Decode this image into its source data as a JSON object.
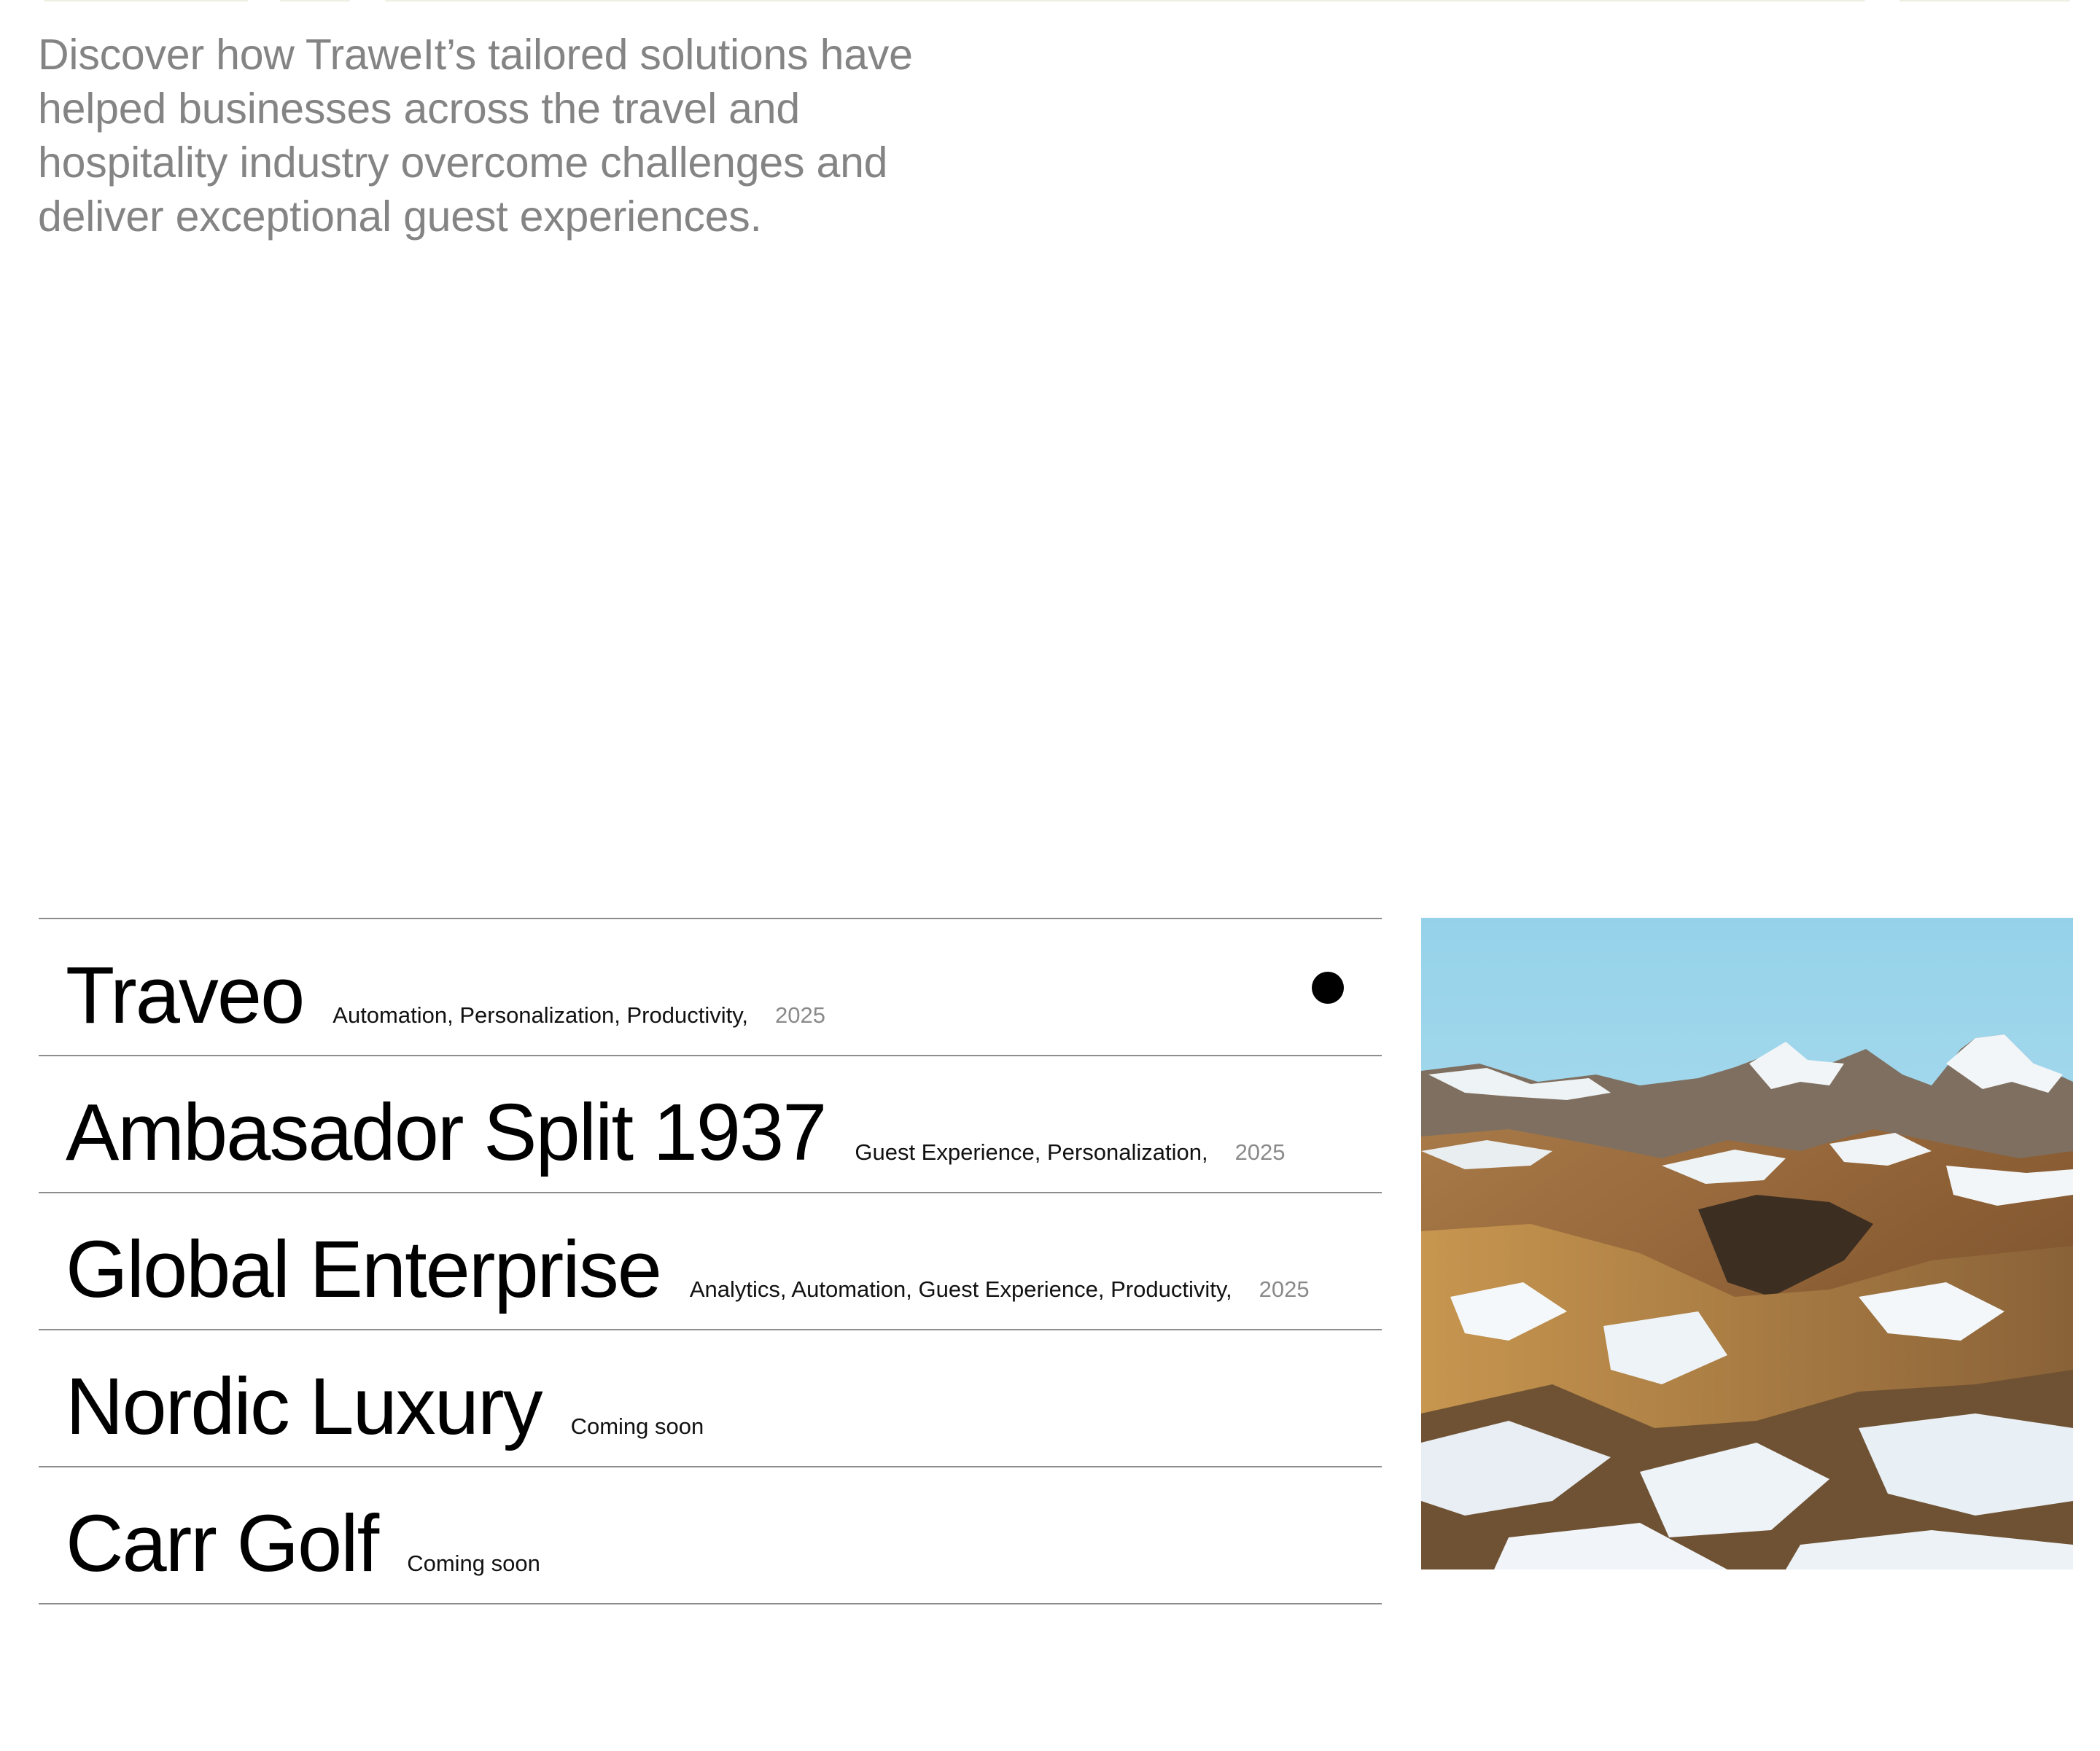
{
  "intro": {
    "text": "Discover how TraweIt’s tailored solutions have helped businesses across the travel and hospitality industry overcome challenges and deliver exceptional guest experiences."
  },
  "cases": [
    {
      "title": "Traveo",
      "tags": "Automation, Personalization, Productivity,",
      "year": "2025",
      "active": true
    },
    {
      "title": "Ambasador Split 1937",
      "tags": "Guest Experience, Personalization,",
      "year": "2025",
      "active": false
    },
    {
      "title": "Global Enterprise",
      "tags": "Analytics, Automation, Guest Experience, Productivity,",
      "year": "2025",
      "active": false
    },
    {
      "title": "Nordic Luxury",
      "tags": "Coming soon",
      "year": "",
      "active": false
    },
    {
      "title": "Carr Golf",
      "tags": "Coming soon",
      "year": "",
      "active": false
    }
  ],
  "preview": {
    "image": "snowy-mountain-landscape"
  },
  "colors": {
    "intro_text": "#848484",
    "divider": "#8d8d8d",
    "year_text": "#8a8a8a",
    "sky": "#a6d6ea"
  }
}
